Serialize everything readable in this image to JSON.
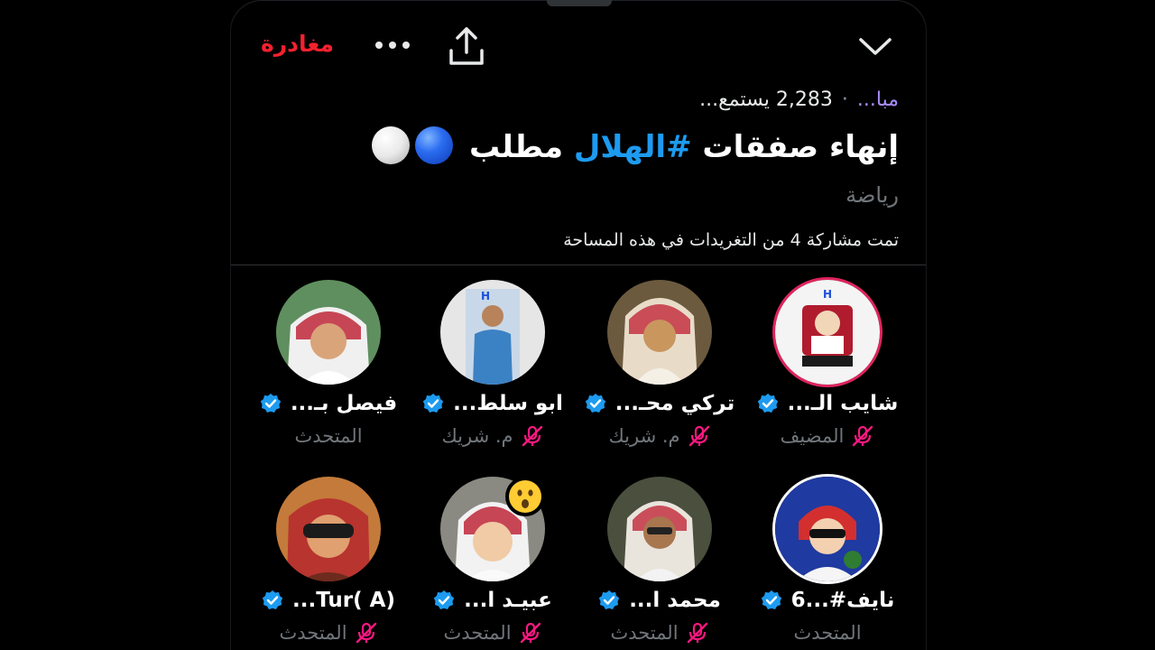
{
  "header": {
    "leave_label": "مغادرة",
    "icons": [
      "chevron-down-icon",
      "share-icon",
      "more-icon"
    ]
  },
  "space": {
    "status": "مبا...",
    "listeners": "2,283 يستمع...",
    "title_part1": "إنهاء صفقات ",
    "title_hashtag": "#الهلال",
    "title_part2": " مطلب",
    "emojis": [
      "blue-circle",
      "white-circle"
    ],
    "category": "رياضة",
    "shared_tweets": "تمت مشاركة 4 من التغريدات في هذه المساحة"
  },
  "participants": [
    {
      "name": "شايب الـ...",
      "role": "المضيف",
      "verified": true,
      "muted": true
    },
    {
      "name": "تركي محـ...",
      "role": "م. شريك",
      "verified": true,
      "muted": true
    },
    {
      "name": "ابو سلط...",
      "role": "م. شريك",
      "verified": true,
      "muted": true
    },
    {
      "name": "فيصل بـ...",
      "role": "المتحدث",
      "verified": true,
      "muted": false
    },
    {
      "name": "نايف#...6",
      "role": "المتحدث",
      "verified": true,
      "muted": false
    },
    {
      "name": "محمد ا...",
      "role": "المتحدث",
      "verified": true,
      "muted": true
    },
    {
      "name": "عبيـد ا...",
      "role": "المتحدث",
      "verified": true,
      "muted": true,
      "reaction": "astonished-face"
    },
    {
      "name": "(A )Tur...",
      "role": "المتحدث",
      "verified": true,
      "muted": true
    }
  ],
  "colors": {
    "leave": "#f4212e",
    "hashtag": "#1d9bf0",
    "verified": "#1d9bf0",
    "muted_mic": "#f91880",
    "secondary_text": "#71767b",
    "host_ring": "#e0245e"
  }
}
